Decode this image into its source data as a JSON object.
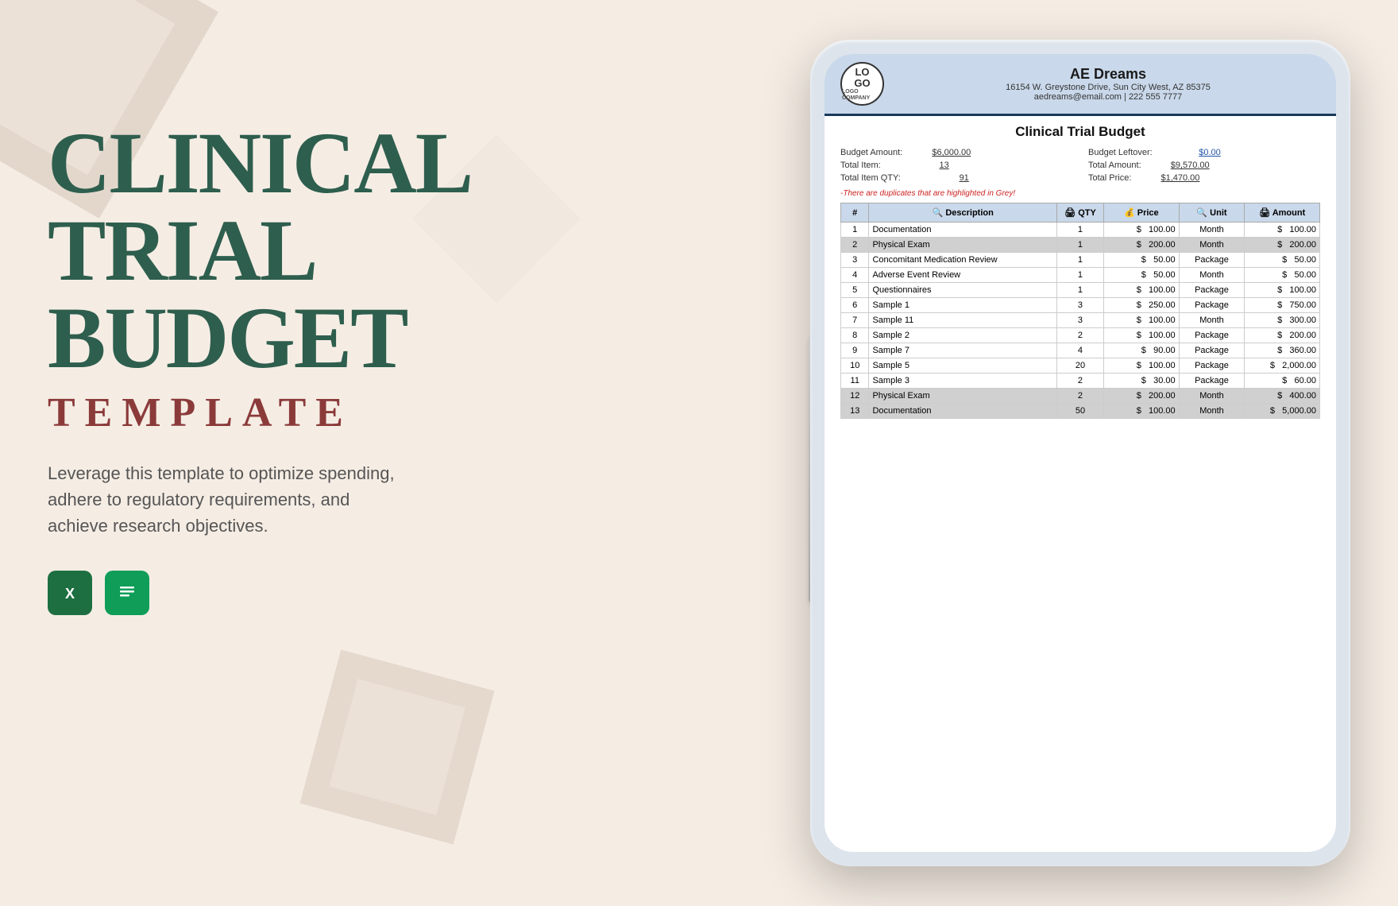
{
  "background": {
    "color": "#f5ede4"
  },
  "left": {
    "title_line1": "CLINICAL",
    "title_line2": "TRIAL",
    "title_line3": "BUDGET",
    "subtitle": "TEMPLATE",
    "description": "Leverage this template to optimize spending, adhere to regulatory requirements, and achieve research objectives.",
    "excel_label": "X",
    "sheets_label": "≡"
  },
  "tablet": {
    "company": {
      "logo_line1": "LO",
      "logo_line2": "GO",
      "logo_line3": "LOGO COMPANY",
      "name": "AE Dreams",
      "address": "16154 W. Greystone Drive, Sun City West, AZ 85375",
      "contact": "aedreams@email.com | 222 555 7777"
    },
    "document": {
      "title": "Clinical Trial Budget",
      "summary": {
        "budget_amount_label": "Budget Amount:",
        "budget_amount_value": "$6,000.00",
        "total_item_label": "Total Item:",
        "total_item_value": "13",
        "total_item_qty_label": "Total Item QTY:",
        "total_item_qty_value": "91",
        "budget_leftover_label": "Budget Leftover:",
        "budget_leftover_value": "$0.00",
        "total_amount_label": "Total Amount:",
        "total_amount_value": "$9,570.00",
        "total_price_label": "Total Price:",
        "total_price_value": "$1,470.00"
      },
      "duplicate_notice": "-There are duplicates that are highlighted in Grey!",
      "table": {
        "headers": [
          "#",
          "Description",
          "QTY",
          "Price",
          "Unit",
          "Amount"
        ],
        "rows": [
          {
            "num": 1,
            "desc": "Documentation",
            "qty": 1,
            "price": "100.00",
            "unit": "Month",
            "amount": "100.00",
            "grey": false
          },
          {
            "num": 2,
            "desc": "Physical Exam",
            "qty": 1,
            "price": "200.00",
            "unit": "Month",
            "amount": "200.00",
            "grey": true
          },
          {
            "num": 3,
            "desc": "Concomitant Medication Review",
            "qty": 1,
            "price": "50.00",
            "unit": "Package",
            "amount": "50.00",
            "grey": false
          },
          {
            "num": 4,
            "desc": "Adverse Event Review",
            "qty": 1,
            "price": "50.00",
            "unit": "Month",
            "amount": "50.00",
            "grey": false
          },
          {
            "num": 5,
            "desc": "Questionnaires",
            "qty": 1,
            "price": "100.00",
            "unit": "Package",
            "amount": "100.00",
            "grey": false
          },
          {
            "num": 6,
            "desc": "Sample 1",
            "qty": 3,
            "price": "250.00",
            "unit": "Package",
            "amount": "750.00",
            "grey": false
          },
          {
            "num": 7,
            "desc": "Sample 11",
            "qty": 3,
            "price": "100.00",
            "unit": "Month",
            "amount": "300.00",
            "grey": false
          },
          {
            "num": 8,
            "desc": "Sample 2",
            "qty": 2,
            "price": "100.00",
            "unit": "Package",
            "amount": "200.00",
            "grey": false
          },
          {
            "num": 9,
            "desc": "Sample 7",
            "qty": 4,
            "price": "90.00",
            "unit": "Package",
            "amount": "360.00",
            "grey": false
          },
          {
            "num": 10,
            "desc": "Sample 5",
            "qty": 20,
            "price": "100.00",
            "unit": "Package",
            "amount": "2,000.00",
            "grey": false
          },
          {
            "num": 11,
            "desc": "Sample 3",
            "qty": 2,
            "price": "30.00",
            "unit": "Package",
            "amount": "60.00",
            "grey": false
          },
          {
            "num": 12,
            "desc": "Physical Exam",
            "qty": 2,
            "price": "200.00",
            "unit": "Month",
            "amount": "400.00",
            "grey": true
          },
          {
            "num": 13,
            "desc": "Documentation",
            "qty": 50,
            "price": "100.00",
            "unit": "Month",
            "amount": "5,000.00",
            "grey": true
          }
        ]
      }
    }
  }
}
